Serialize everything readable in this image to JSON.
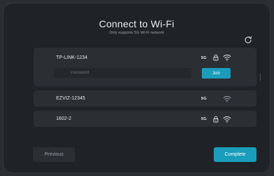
{
  "header": {
    "title": "Connect to Wi-Fi",
    "subtitle": "Only supports 5G Wi-Fi network",
    "refresh_icon": "refresh-icon"
  },
  "networks": [
    {
      "ssid": "TP-LINK-1234",
      "band": "5G",
      "secured": true,
      "expanded": true,
      "password_placeholder": "Password",
      "join_label": "Join"
    },
    {
      "ssid": "EZVIZ-12345",
      "band": "5G",
      "secured": false
    },
    {
      "ssid": "1602-2",
      "band": "5G",
      "secured": true
    }
  ],
  "footer": {
    "previous_label": "Previous",
    "complete_label": "Complete"
  },
  "colors": {
    "accent": "#1a9dba",
    "background": "#1f2226",
    "row": "#2b2e33",
    "text": "#e3e6ea"
  }
}
